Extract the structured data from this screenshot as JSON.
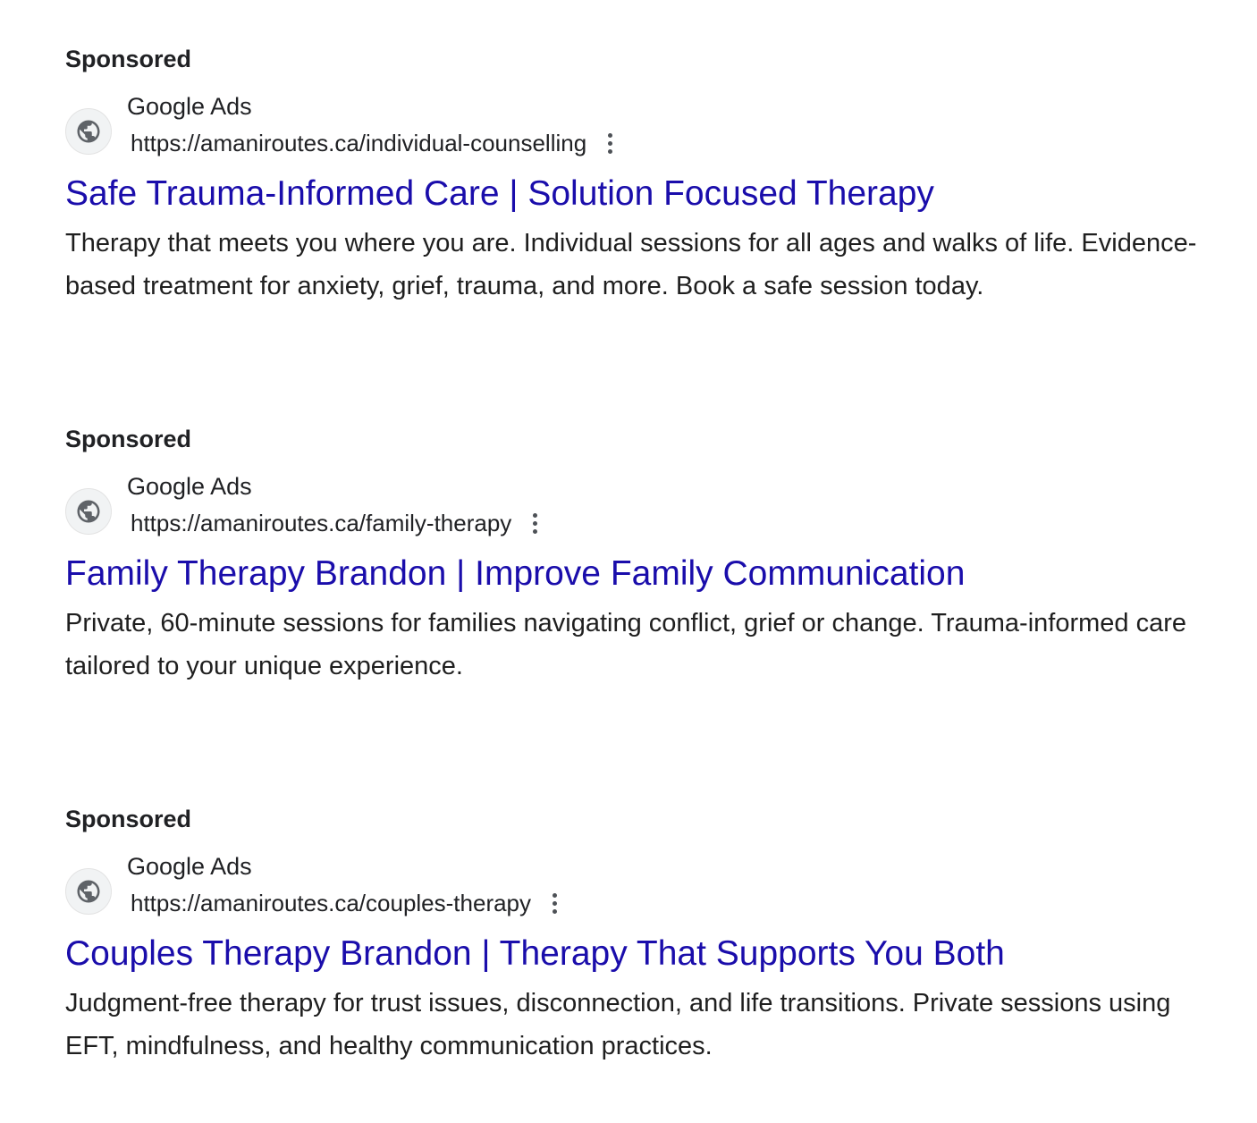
{
  "colors": {
    "link": "#1a0dab",
    "text": "#1f1f1f",
    "label": "#202124",
    "icon": "#5f6368"
  },
  "ads": [
    {
      "label": "Sponsored",
      "source_name": "Google Ads",
      "display_url": "https://amaniroutes.ca/individual-counselling",
      "headline": "Safe Trauma-Informed Care | Solution Focused Therapy",
      "description": "Therapy that meets you where you are. Individual sessions for all ages and walks of life. Evidence-based treatment for anxiety, grief, trauma, and more. Book a safe session today.",
      "icon": "globe-icon"
    },
    {
      "label": "Sponsored",
      "source_name": "Google Ads",
      "display_url": "https://amaniroutes.ca/family-therapy",
      "headline": "Family Therapy Brandon | Improve Family Communication",
      "description": "Private, 60-minute sessions for families navigating conflict, grief or change. Trauma-informed care tailored to your unique experience.",
      "icon": "globe-icon"
    },
    {
      "label": "Sponsored",
      "source_name": "Google Ads",
      "display_url": "https://amaniroutes.ca/couples-therapy",
      "headline": "Couples Therapy Brandon | Therapy That Supports You Both",
      "description": "Judgment-free therapy for trust issues, disconnection, and life transitions. Private sessions using EFT, mindfulness, and healthy communication practices.",
      "icon": "globe-icon"
    }
  ]
}
